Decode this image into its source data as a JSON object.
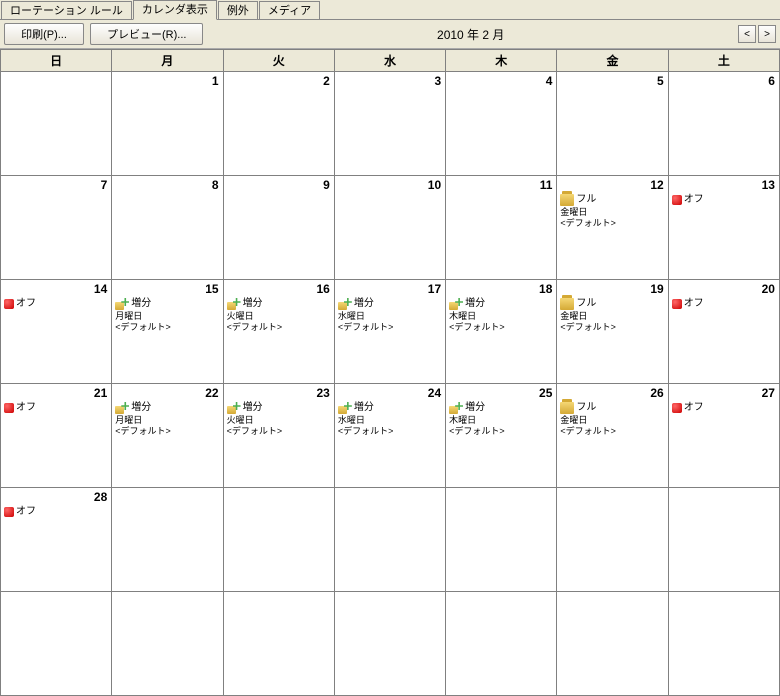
{
  "tabs": {
    "rotation": "ローテーション ルール",
    "calendar": "カレンダ表示",
    "exception": "例外",
    "media": "メディア"
  },
  "toolbar": {
    "print": "印刷(P)...",
    "preview": "プレビュー(R)...",
    "title": "2010 年 2 月"
  },
  "nav": {
    "prev": "<",
    "next": ">"
  },
  "weekdays": [
    "日",
    "月",
    "火",
    "水",
    "木",
    "金",
    "土"
  ],
  "event_labels": {
    "off": "オフ",
    "full": "フル",
    "inc": "増分",
    "default": "<デフォルト>",
    "mon": "月曜日",
    "tue": "火曜日",
    "wed": "水曜日",
    "thu": "木曜日",
    "fri": "金曜日"
  },
  "calendar": [
    [
      {
        "day": ""
      },
      {
        "day": "1"
      },
      {
        "day": "2"
      },
      {
        "day": "3"
      },
      {
        "day": "4"
      },
      {
        "day": "5"
      },
      {
        "day": "6"
      }
    ],
    [
      {
        "day": "7"
      },
      {
        "day": "8"
      },
      {
        "day": "9"
      },
      {
        "day": "10"
      },
      {
        "day": "11"
      },
      {
        "day": "12",
        "ev": {
          "type": "full",
          "wd": "fri"
        }
      },
      {
        "day": "13",
        "ev": {
          "type": "off"
        }
      }
    ],
    [
      {
        "day": "14",
        "ev": {
          "type": "off"
        }
      },
      {
        "day": "15",
        "ev": {
          "type": "inc",
          "wd": "mon"
        }
      },
      {
        "day": "16",
        "ev": {
          "type": "inc",
          "wd": "tue"
        }
      },
      {
        "day": "17",
        "ev": {
          "type": "inc",
          "wd": "wed"
        }
      },
      {
        "day": "18",
        "ev": {
          "type": "inc",
          "wd": "thu"
        }
      },
      {
        "day": "19",
        "ev": {
          "type": "full",
          "wd": "fri"
        }
      },
      {
        "day": "20",
        "ev": {
          "type": "off"
        }
      }
    ],
    [
      {
        "day": "21",
        "ev": {
          "type": "off"
        }
      },
      {
        "day": "22",
        "ev": {
          "type": "inc",
          "wd": "mon"
        }
      },
      {
        "day": "23",
        "ev": {
          "type": "inc",
          "wd": "tue"
        }
      },
      {
        "day": "24",
        "ev": {
          "type": "inc",
          "wd": "wed"
        }
      },
      {
        "day": "25",
        "ev": {
          "type": "inc",
          "wd": "thu"
        }
      },
      {
        "day": "26",
        "ev": {
          "type": "full",
          "wd": "fri"
        }
      },
      {
        "day": "27",
        "ev": {
          "type": "off"
        }
      }
    ],
    [
      {
        "day": "28",
        "ev": {
          "type": "off"
        }
      },
      {
        "day": ""
      },
      {
        "day": ""
      },
      {
        "day": ""
      },
      {
        "day": ""
      },
      {
        "day": ""
      },
      {
        "day": ""
      }
    ],
    [
      {
        "day": ""
      },
      {
        "day": ""
      },
      {
        "day": ""
      },
      {
        "day": ""
      },
      {
        "day": ""
      },
      {
        "day": ""
      },
      {
        "day": ""
      }
    ]
  ]
}
